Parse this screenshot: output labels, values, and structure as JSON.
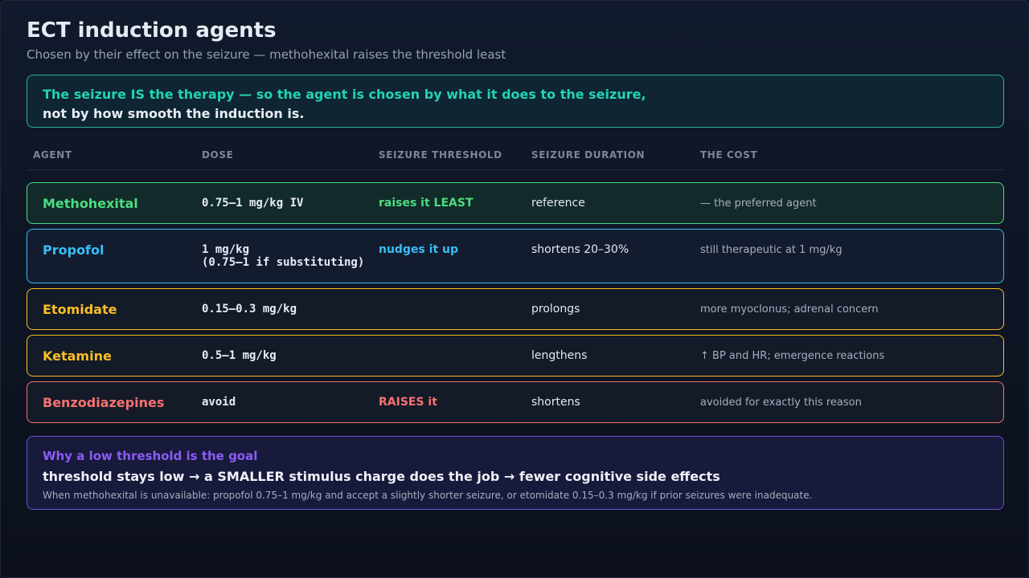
{
  "header": {
    "title": "ECT induction agents",
    "subtitle": "Chosen by their effect on the seizure — methohexital raises the threshold least"
  },
  "callout": {
    "line1": "The seizure IS the therapy — so the agent is chosen by what it does to the seizure,",
    "line2": "not by how smooth the induction is."
  },
  "table": {
    "columns": [
      "AGENT",
      "DOSE",
      "SEIZURE THRESHOLD",
      "SEIZURE DURATION",
      "THE COST"
    ],
    "rows": [
      {
        "agent": "Methohexital",
        "dose": [
          "0.75–1 mg/kg IV"
        ],
        "threshold": "raises it LEAST",
        "duration": "reference",
        "cost": "— the preferred agent",
        "color": "#4ade80"
      },
      {
        "agent": "Propofol",
        "dose": [
          "1 mg/kg",
          "(0.75–1 if substituting)"
        ],
        "threshold": "nudges it up",
        "duration": "shortens 20–30%",
        "cost": "still therapeutic at 1 mg/kg",
        "color": "#38bdf8"
      },
      {
        "agent": "Etomidate",
        "dose": [
          "0.15–0.3 mg/kg"
        ],
        "threshold": "",
        "duration": "prolongs",
        "cost": "more myoclonus; adrenal concern",
        "color": "#fbbf24"
      },
      {
        "agent": "Ketamine",
        "dose": [
          "0.5–1 mg/kg"
        ],
        "threshold": "",
        "duration": "lengthens",
        "cost": "↑ BP and HR; emergence reactions",
        "color": "#fbbf24"
      },
      {
        "agent": "Benzodiazepines",
        "dose": [
          "avoid"
        ],
        "threshold": "RAISES it",
        "duration": "shortens",
        "cost": "avoided for exactly this reason",
        "color": "#f87171"
      }
    ]
  },
  "bottom": {
    "heading": "Why a low threshold is the goal",
    "main": "threshold stays low → a SMALLER stimulus charge does the job → fewer cognitive side effects",
    "note": "When methohexital is unavailable: propofol 0.75–1 mg/kg and accept a slightly shorter seizure, or etomidate 0.15–0.3 mg/kg if prior seizures were inadequate."
  }
}
